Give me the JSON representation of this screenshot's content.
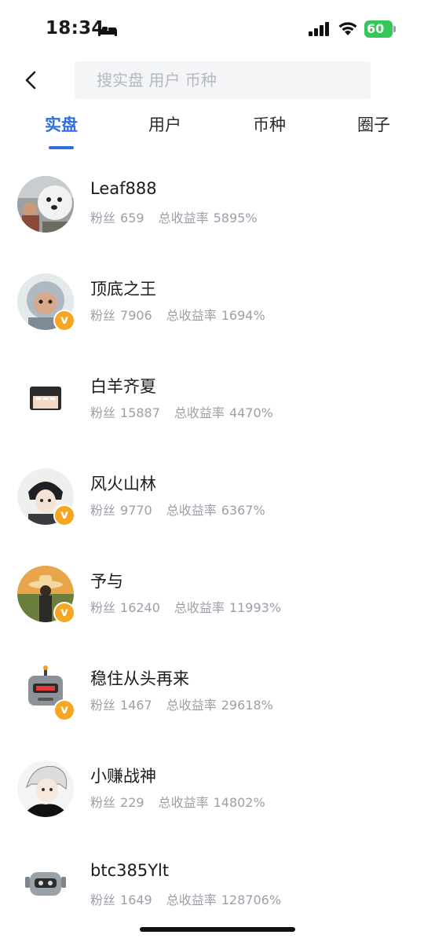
{
  "status_bar": {
    "time": "18:34",
    "battery": "60"
  },
  "search": {
    "placeholder": "搜实盘 用户 币种",
    "value": ""
  },
  "tabs": [
    {
      "label": "实盘",
      "active": true
    },
    {
      "label": "用户",
      "active": false
    },
    {
      "label": "币种",
      "active": false
    },
    {
      "label": "圈子",
      "active": false
    }
  ],
  "colors": {
    "accent": "#2f6fde",
    "badge": "#f5a623",
    "muted_text": "#9ba0a8",
    "battery": "#34c759"
  },
  "users": [
    {
      "name": "Leaf888",
      "fans_label": "粉丝",
      "fans": "659",
      "yield_label": "总收益率",
      "yield": "5895%",
      "verified": false,
      "avatar_icon": "dog-photo-avatar"
    },
    {
      "name": "顶底之王",
      "fans_label": "粉丝",
      "fans": "7906",
      "yield_label": "总收益率",
      "yield": "1694%",
      "verified": true,
      "avatar_icon": "hooded-kid-avatar"
    },
    {
      "name": "白羊齐夏",
      "fans_label": "粉丝",
      "fans": "15887",
      "yield_label": "总收益率",
      "yield": "4470%",
      "verified": false,
      "avatar_icon": "pixel-face-avatar"
    },
    {
      "name": "风火山林",
      "fans_label": "粉丝",
      "fans": "9770",
      "yield_label": "总收益率",
      "yield": "6367%",
      "verified": true,
      "avatar_icon": "anime-boy-avatar"
    },
    {
      "name": "予与",
      "fans_label": "粉丝",
      "fans": "16240",
      "yield_label": "总收益率",
      "yield": "11993%",
      "verified": true,
      "avatar_icon": "sunset-hat-avatar"
    },
    {
      "name": "稳住从头再来",
      "fans_label": "粉丝",
      "fans": "1467",
      "yield_label": "总收益率",
      "yield": "29618%",
      "verified": true,
      "avatar_icon": "robot-avatar"
    },
    {
      "name": "小赚战神",
      "fans_label": "粉丝",
      "fans": "229",
      "yield_label": "总收益率",
      "yield": "14802%",
      "verified": false,
      "avatar_icon": "white-hair-anime-avatar"
    },
    {
      "name": "btc385Ylt",
      "fans_label": "粉丝",
      "fans": "1649",
      "yield_label": "总收益率",
      "yield": "128706%",
      "verified": false,
      "avatar_icon": "gray-robot-avatar"
    }
  ]
}
